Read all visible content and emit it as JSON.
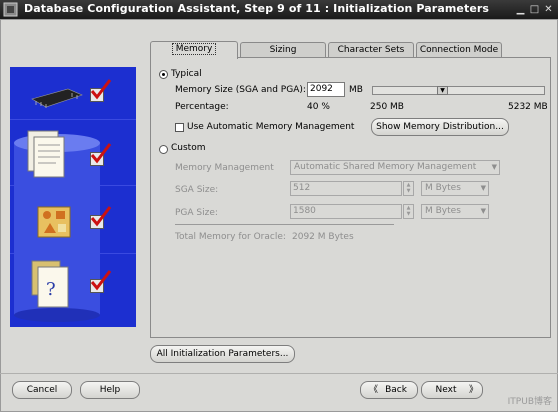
{
  "window": {
    "title": "Database Configuration Assistant, Step 9 of 11 : Initialization Parameters"
  },
  "tabs": [
    {
      "label": "Memory",
      "active": true
    },
    {
      "label": "Sizing",
      "active": false
    },
    {
      "label": "Character Sets",
      "active": false
    },
    {
      "label": "Connection Mode",
      "active": false
    }
  ],
  "memory": {
    "typical_label": "Typical",
    "typical_selected": true,
    "memory_size_label": "Memory Size (SGA and PGA):",
    "memory_size_value": "2092",
    "memory_size_unit": "MB",
    "percentage_label": "Percentage:",
    "percentage_value": "40 %",
    "slider_min": "250 MB",
    "slider_max": "5232 MB",
    "slider_level": 0.4,
    "auto_mm_label": "Use Automatic Memory Management",
    "auto_mm_checked": false,
    "show_dist_button": "Show Memory Distribution...",
    "custom_label": "Custom",
    "custom_selected": false,
    "mm_label": "Memory Management",
    "mm_value": "Automatic Shared Memory Management",
    "sga_label": "SGA Size:",
    "sga_value": "512",
    "sga_unit": "M Bytes",
    "pga_label": "PGA Size:",
    "pga_value": "1580",
    "pga_unit": "M Bytes",
    "total_label": "Total Memory for Oracle:",
    "total_value": "2092 M Bytes"
  },
  "buttons": {
    "all_params": "All Initialization Parameters...",
    "cancel": "Cancel",
    "help": "Help",
    "back": "Back",
    "next": "Next"
  },
  "watermark": "ITPUB博客",
  "colors": {
    "side_panel": "#1c2fd0",
    "check_red": "#cc1111"
  }
}
